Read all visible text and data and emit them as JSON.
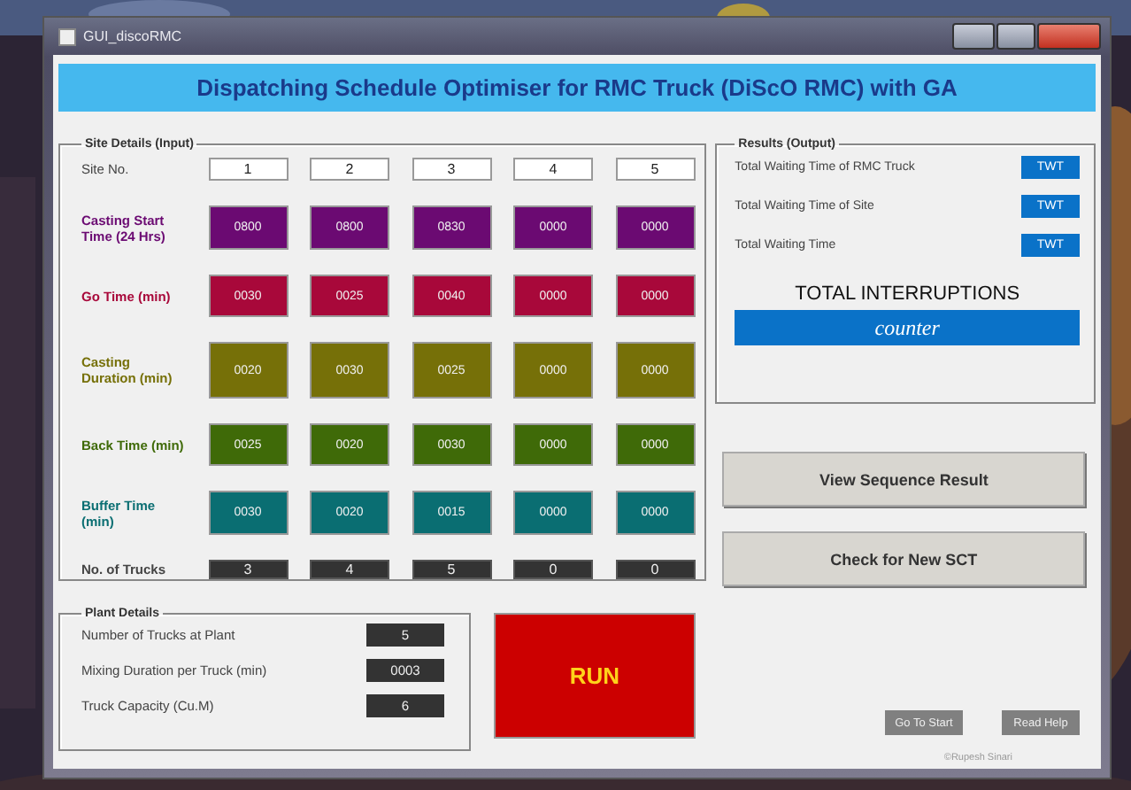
{
  "window": {
    "title": "GUI_discoRMC"
  },
  "banner": "Dispatching Schedule Optimiser for RMC Truck (DiScO RMC) with GA",
  "site_details": {
    "title": "Site Details (Input)",
    "site_label": "Site No.",
    "sites": [
      "1",
      "2",
      "3",
      "4",
      "5"
    ],
    "rows": [
      {
        "label": "Casting Start Time (24 Hrs)",
        "color": "#6b0a72",
        "values": [
          "0800",
          "0800",
          "0830",
          "0000",
          "0000"
        ]
      },
      {
        "label": "Go Time (min)",
        "color": "#a8083a",
        "values": [
          "0030",
          "0025",
          "0040",
          "0000",
          "0000"
        ]
      },
      {
        "label": "Casting Duration (min)",
        "color": "#767008",
        "values": [
          "0020",
          "0030",
          "0025",
          "0000",
          "0000"
        ]
      },
      {
        "label": "Back Time (min)",
        "color": "#3f6a08",
        "values": [
          "0025",
          "0020",
          "0030",
          "0000",
          "0000"
        ]
      },
      {
        "label": "Buffer Time (min)",
        "color": "#0a6e72",
        "values": [
          "0030",
          "0020",
          "0015",
          "0000",
          "0000"
        ]
      }
    ],
    "trucks_label": "No. of Trucks",
    "trucks": [
      "3",
      "4",
      "5",
      "0",
      "0"
    ]
  },
  "results": {
    "title": "Results (Output)",
    "items": [
      {
        "label": "Total Waiting Time of RMC Truck",
        "value": "TWT"
      },
      {
        "label": "Total Waiting Time of Site",
        "value": "TWT"
      },
      {
        "label": "Total Waiting Time",
        "value": "TWT"
      }
    ],
    "interruptions_label": "TOTAL INTERRUPTIONS",
    "counter": "counter"
  },
  "actions": [
    "View Sequence Result",
    "Check for New SCT"
  ],
  "plant_details": {
    "title": "Plant Details",
    "fields": [
      {
        "label": "Number of Trucks at Plant",
        "value": "5"
      },
      {
        "label": "Mixing Duration per Truck (min)",
        "value": "0003"
      },
      {
        "label": "Truck Capacity (Cu.M)",
        "value": "6"
      }
    ]
  },
  "run_button": "RUN",
  "small_buttons": [
    "Go To Start",
    "Read Help"
  ],
  "footer": "©Rupesh Sinari"
}
